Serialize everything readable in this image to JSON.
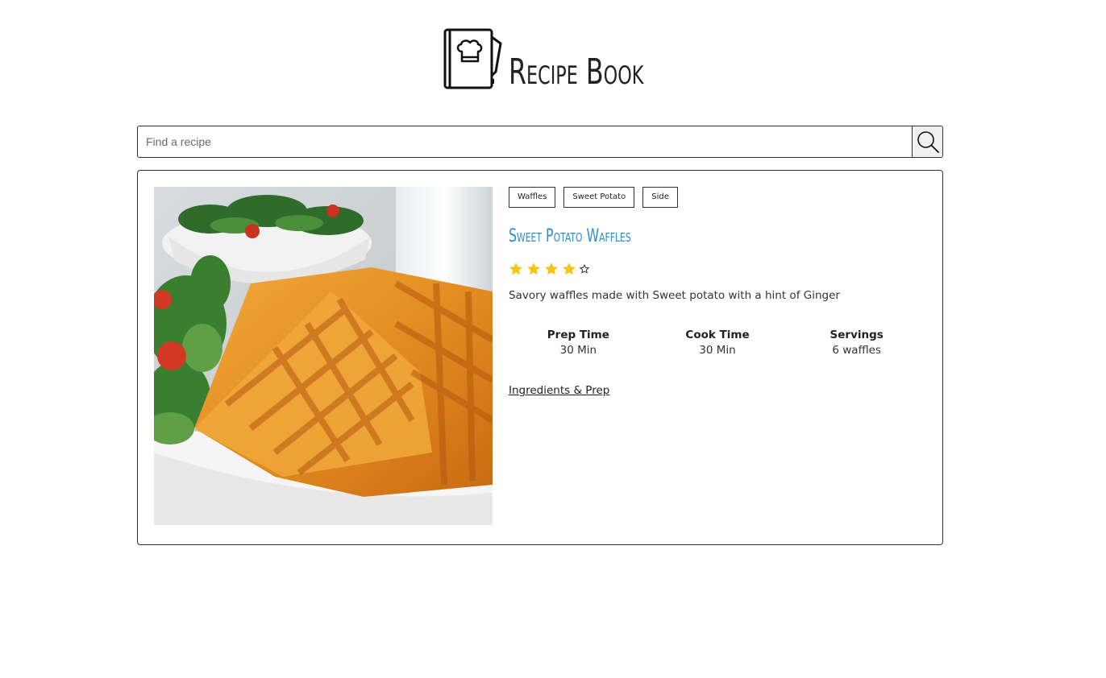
{
  "brand": {
    "name": "Recipe Book",
    "logo_icon": "cookbook-chef-hat-icon"
  },
  "search": {
    "placeholder": "Find a recipe",
    "value": "",
    "button_icon": "search-icon"
  },
  "recipe": {
    "image_alt": "sweet-potato-waffles-photo",
    "tags": [
      "Waffles",
      "Sweet Potato",
      "Side"
    ],
    "title": "Sweet Potato Waffles",
    "rating": {
      "value": 4,
      "max": 5
    },
    "description": "Savory waffles made with Sweet potato with a hint of Ginger",
    "stats": [
      {
        "label": "Prep Time",
        "value": "30 Min"
      },
      {
        "label": "Cook Time",
        "value": "30 Min"
      },
      {
        "label": "Servings",
        "value": "6 waffles"
      }
    ],
    "link_label": "Ingredients & Prep"
  },
  "colors": {
    "title": "#2b8dd4",
    "star": "#f5c518",
    "border": "#333333"
  }
}
